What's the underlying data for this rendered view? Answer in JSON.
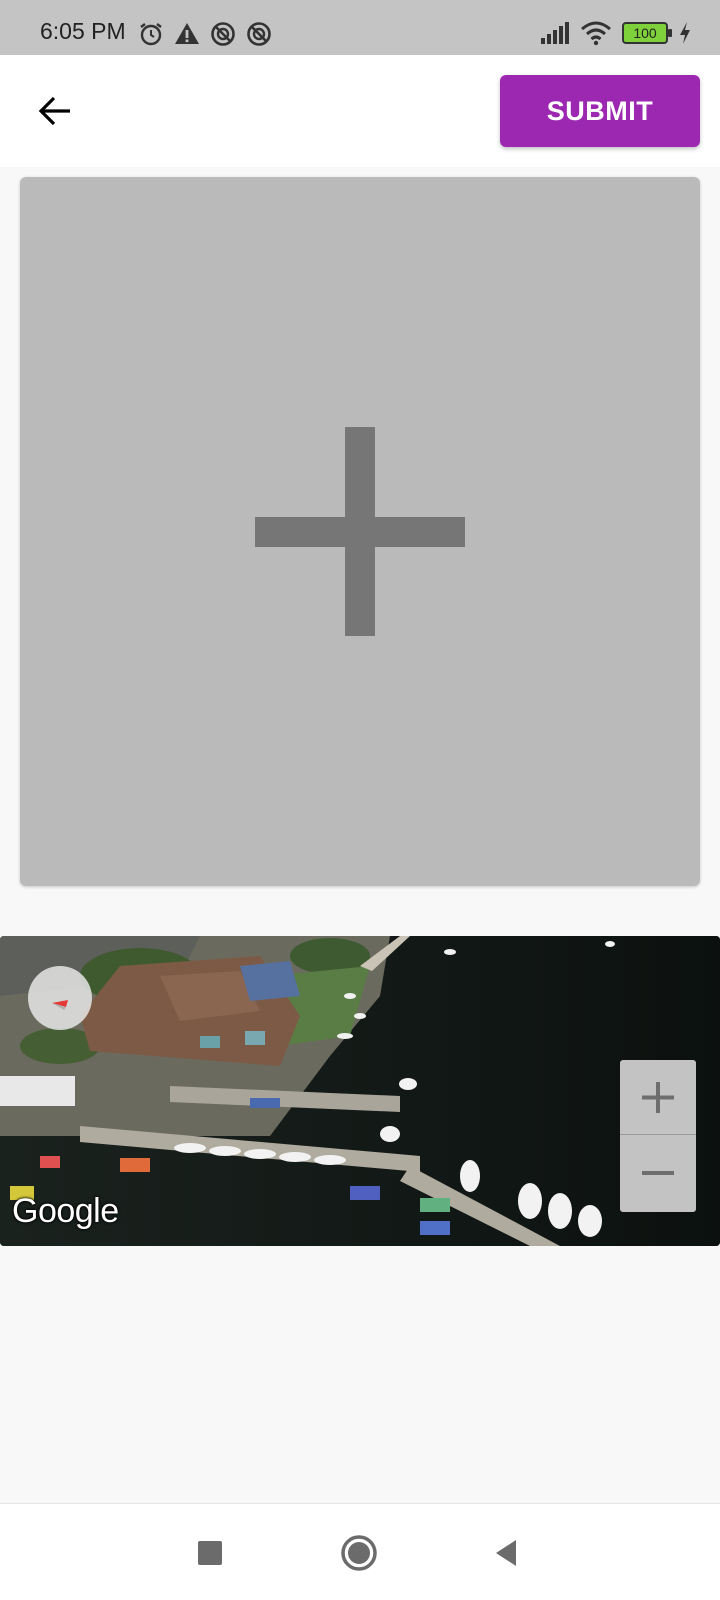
{
  "status_bar": {
    "time": "6:05 PM",
    "battery": "100",
    "icons": [
      "alarm-icon",
      "warning-icon",
      "sync-disabled-icon",
      "sync-disabled-icon",
      "signal-icon",
      "wifi-icon",
      "battery-icon",
      "charging-icon"
    ]
  },
  "toolbar": {
    "back_icon": "arrow-left-icon",
    "submit_label": "SUBMIT",
    "accent_color": "#9c27b0"
  },
  "image_placeholder": {
    "icon": "plus-icon",
    "background": "#bababa"
  },
  "map": {
    "attribution": "Google",
    "zoom_in_icon": "plus-icon",
    "zoom_out_icon": "minus-icon",
    "compass_icon": "compass-icon"
  },
  "nav_bar": {
    "icons": [
      "recents-square-icon",
      "home-circle-icon",
      "back-triangle-icon"
    ]
  }
}
